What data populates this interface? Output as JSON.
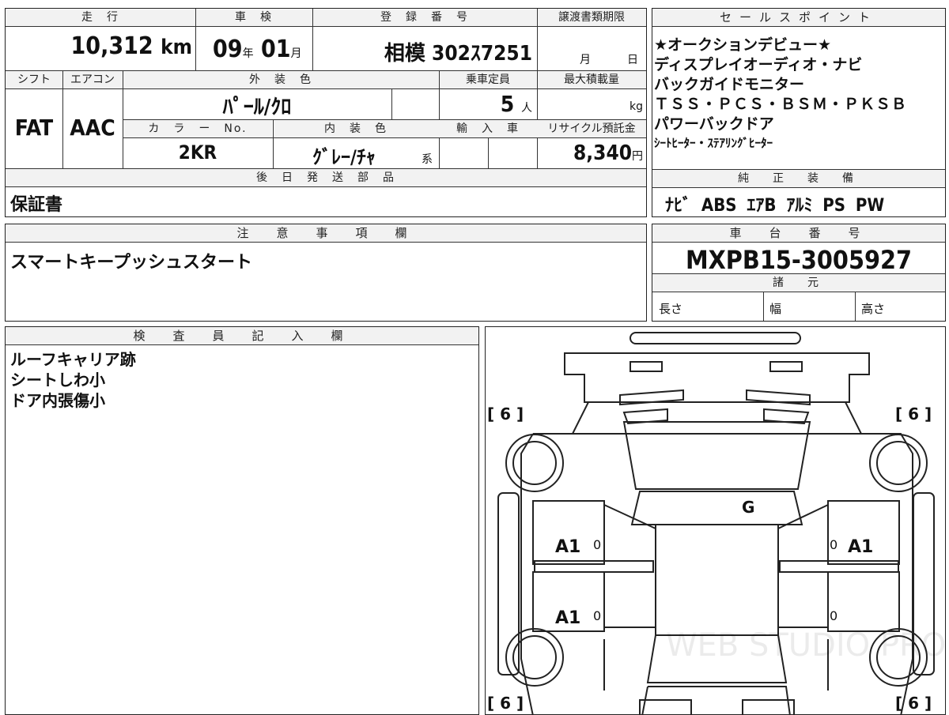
{
  "top_table": {
    "labels": {
      "mileage": "走　行",
      "inspection": "車　検",
      "registration": "登　録　番　号",
      "transfer_deadline": "譲渡書類期限",
      "shift": "シフト",
      "aircon": "エアコン",
      "exterior_color": "外　装　色",
      "capacity": "乗車定員",
      "max_load": "最大積載量",
      "color_no": "カ　ラ　ー　No.",
      "interior_color": "内　装　色",
      "import": "輸　入　車",
      "recycle_fee": "リサイクル預託金",
      "after_parts": "後　日　発　送　部　品"
    },
    "mileage_value": "10,312",
    "mileage_unit": "km",
    "inspection_year": "09",
    "inspection_year_unit": "年",
    "inspection_month": "01",
    "inspection_month_unit": "月",
    "registration_number": "相模 302ｽ7251",
    "transfer_month_unit": "月",
    "transfer_day_unit": "日",
    "shift_value": "FAT",
    "aircon_value": "AAC",
    "exterior_color_value": "ﾊﾟｰﾙ/ｸﾛ",
    "capacity_value": "5",
    "capacity_unit": "人",
    "max_load_unit": "kg",
    "color_no_value": "2KR",
    "interior_color_value": "ｸﾞﾚｰ/ﾁｬ",
    "interior_suffix": "系",
    "recycle_fee_value": "8,340",
    "recycle_fee_unit": "円",
    "after_parts_value": "保証書"
  },
  "sales_points": {
    "header": "セールスポイント",
    "lines": [
      "★オークションデビュー★",
      "ディスプレイオーディオ・ナビ",
      "バックガイドモニター",
      "ＴＳＳ・ＰＣＳ・ＢＳＭ・ＰＫＳＢ",
      "パワーバックドア",
      "ｼｰﾄﾋｰﾀｰ・ｽﾃｱﾘﾝｸﾞﾋｰﾀｰ"
    ],
    "equipment_header": "純　正　装　備",
    "equipment_value": "ﾅﾋﾞ ABS ｴｱB ｱﾙﾐ PS PW"
  },
  "notes": {
    "header": "注　意　事　項　欄",
    "value": "スマートキープッシュスタート"
  },
  "chassis": {
    "header": "車　台　番　号",
    "value": "MXPB15-3005927",
    "spec_header": "諸　元",
    "length": "長さ",
    "width": "幅",
    "height": "高さ"
  },
  "inspector": {
    "header": "検　査　員　記　入　欄",
    "lines": [
      "ルーフキャリア跡",
      "シートしわ小",
      "ドア内張傷小"
    ]
  },
  "diagram": {
    "tire_tl": "[ 6 ]",
    "tire_tr": "[ 6 ]",
    "tire_bl": "[ 6 ]",
    "tire_br": "[ 6 ]",
    "windshield_mark": "G",
    "front_left_door": "A1",
    "front_left_door_num": "0",
    "rear_left_door": "A1",
    "rear_left_door_num": "0",
    "front_right_door": "A1",
    "front_right_door_num": "0",
    "rear_right_door_num": "0",
    "watermark": "WEB STUDIO PRO"
  }
}
